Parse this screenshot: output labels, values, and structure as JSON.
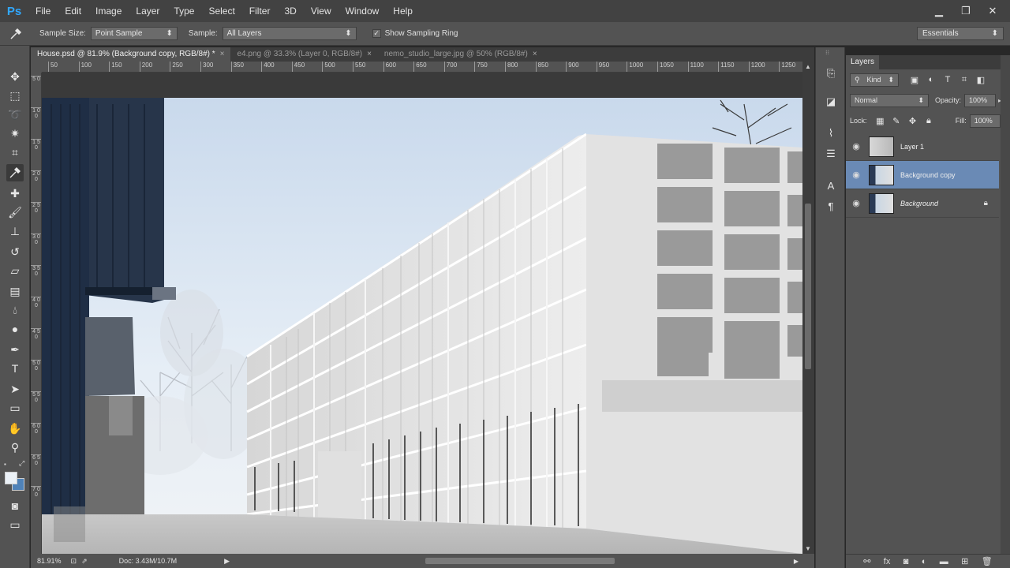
{
  "app": {
    "logo": "Ps"
  },
  "menu": [
    "File",
    "Edit",
    "Image",
    "Layer",
    "Type",
    "Select",
    "Filter",
    "3D",
    "View",
    "Window",
    "Help"
  ],
  "window_controls": {
    "minimize": "▁",
    "restore": "❐",
    "close": "✕"
  },
  "options": {
    "sample_size_label": "Sample Size:",
    "sample_size_value": "Point Sample",
    "sample_label": "Sample:",
    "sample_value": "All Layers",
    "show_ring_label": "Show Sampling Ring",
    "show_ring_checked": "✓",
    "workspace": "Essentials"
  },
  "tabs": [
    {
      "label": "House.psd @ 81.9% (Background copy, RGB/8#) *",
      "close": "×"
    },
    {
      "label": "e4.png @ 33.3% (Layer 0, RGB/8#)",
      "close": "×"
    },
    {
      "label": "nemo_studio_large.jpg @ 50% (RGB/8#)",
      "close": "×"
    }
  ],
  "ruler_h": [
    "50",
    "100",
    "150",
    "200",
    "250",
    "300",
    "350",
    "400",
    "450",
    "500",
    "550",
    "600",
    "650",
    "700",
    "750",
    "800",
    "850",
    "900",
    "950",
    "1000",
    "1050",
    "1100",
    "1150",
    "1200",
    "1250"
  ],
  "ruler_v": [
    "5 0",
    "1 0 0",
    "1 5 0",
    "2 0 0",
    "2 5 0",
    "3 0 0",
    "3 5 0",
    "4 0 0",
    "4 5 0",
    "5 0 0",
    "5 5 0",
    "6 0 0",
    "6 5 0",
    "7 0 0"
  ],
  "status": {
    "zoom": "81.91%",
    "doc": "Doc: 3.43M/10.7M",
    "arrow": "▶"
  },
  "layers_panel": {
    "title": "Layers",
    "filter": "Kind",
    "blend_mode": "Normal",
    "opacity_label": "Opacity:",
    "opacity_value": "100%",
    "lock_label": "Lock:",
    "fill_label": "Fill:",
    "fill_value": "100%",
    "layers": [
      {
        "name": "Layer 1",
        "selected": false,
        "locked": false
      },
      {
        "name": "Background copy",
        "selected": true,
        "locked": false
      },
      {
        "name": "Background",
        "selected": false,
        "locked": true
      }
    ]
  },
  "colors": {
    "accent": "#31a8ff",
    "selection": "#6a8ab5",
    "panel": "#535353"
  }
}
